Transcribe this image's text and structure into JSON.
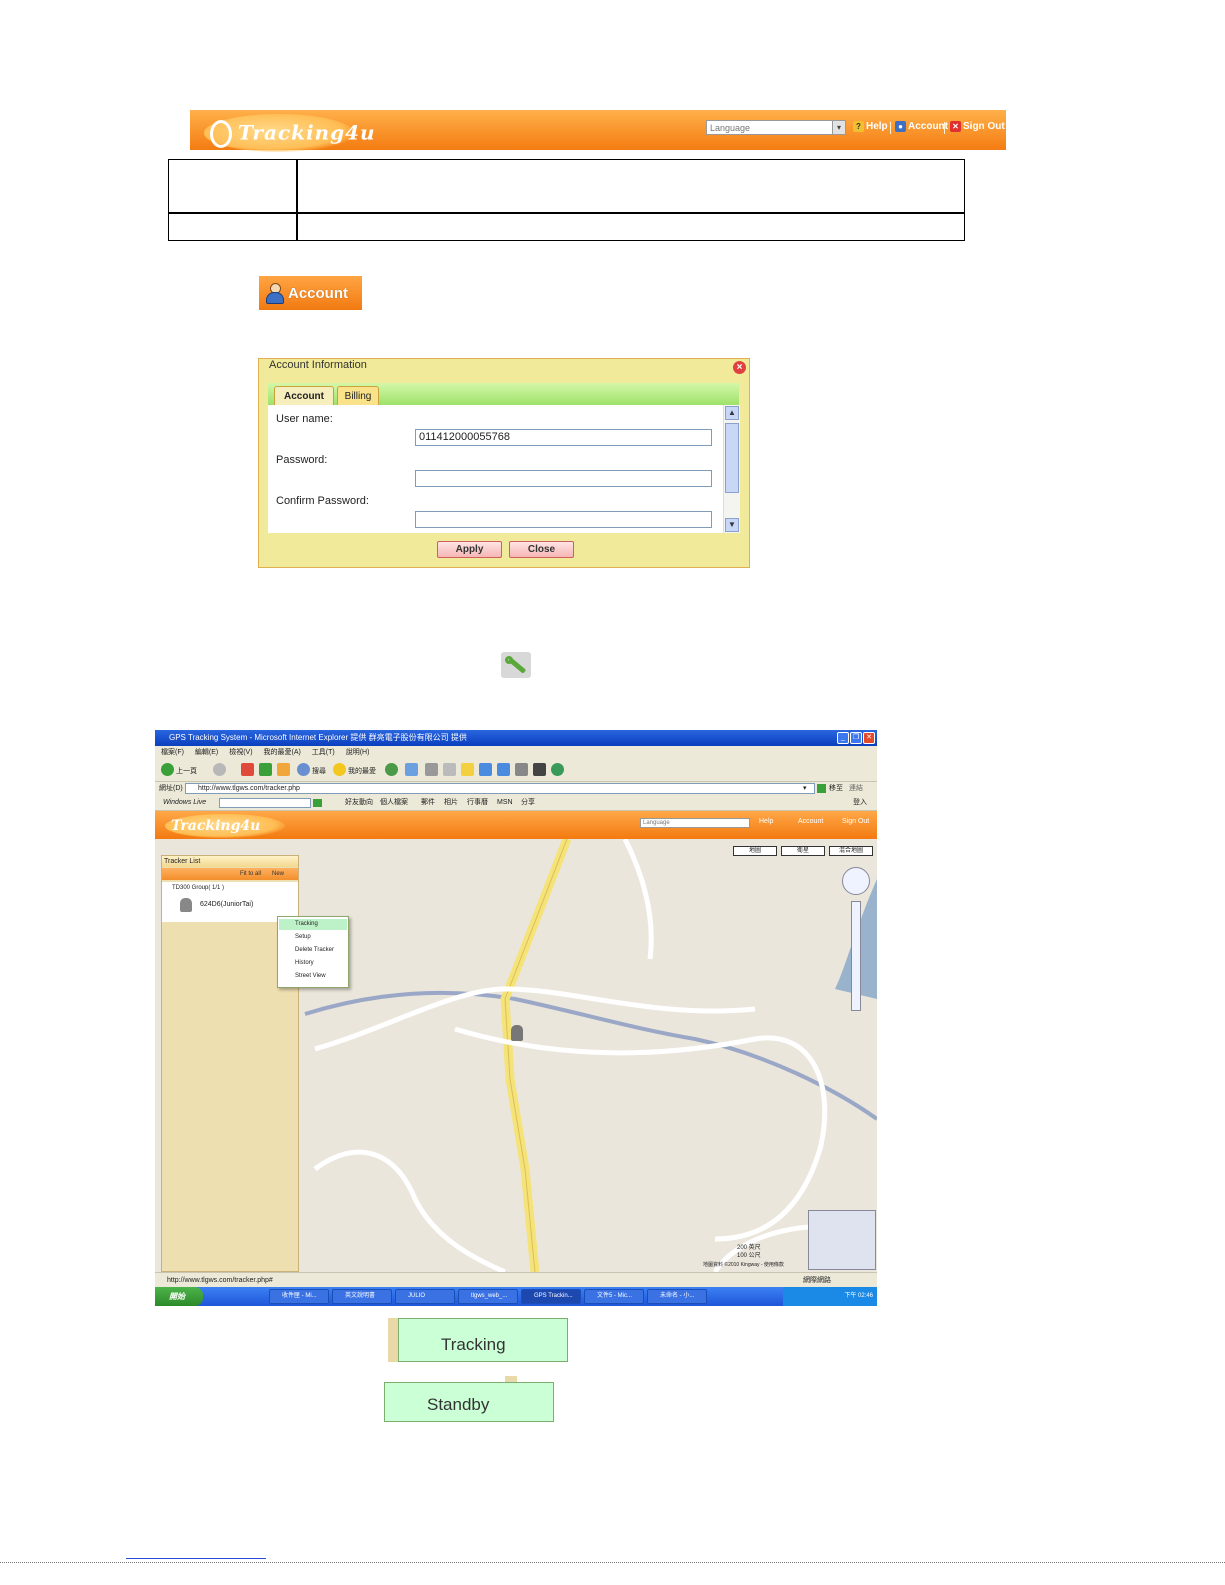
{
  "header": {
    "logo_text": "Tracking4u",
    "language_placeholder": "Language",
    "help_label": "Help",
    "account_label": "Account",
    "signout_label": "Sign Out"
  },
  "account_button": {
    "label": "Account"
  },
  "dialog": {
    "title": "Account Information",
    "tabs": [
      {
        "label": "Account",
        "active": true
      },
      {
        "label": "Billing",
        "active": false
      }
    ],
    "fields": [
      {
        "label": "User name:",
        "value": "011412000055768"
      },
      {
        "label": "Password:",
        "value": ""
      },
      {
        "label": "Confirm Password:",
        "value": ""
      }
    ],
    "apply_label": "Apply",
    "close_label": "Close"
  },
  "browser": {
    "window_title": "GPS Tracking System - Microsoft Internet Explorer 提供 群亮電子股份有限公司 提供",
    "menu": [
      "檔案(F)",
      "編輯(E)",
      "檢視(V)",
      "我的最愛(A)",
      "工具(T)",
      "說明(H)"
    ],
    "toolbar": {
      "back": "上一頁",
      "search": "搜尋",
      "favorites": "我的最愛"
    },
    "address_label": "網址(D)",
    "address": "http://www.tlgws.com/tracker.php",
    "go_label": "移至",
    "links_label": "連結",
    "live_label": "Windows Live",
    "live_links": [
      "好友動向",
      "個人檔案",
      "郵件",
      "相片",
      "行事曆",
      "MSN",
      "分享"
    ],
    "live_signin": "登入",
    "app": {
      "language_placeholder": "Language",
      "help": "Help",
      "account": "Account",
      "signout": "Sign Out"
    },
    "map_types": [
      "地圖",
      "衛星",
      "混合地圖"
    ],
    "tracker_panel": {
      "title": "Tracker List",
      "fit_label": "Fit to all",
      "new_label": "New",
      "group_label": "TD300 Group( 1/1 )",
      "tracker_name": "624D6(JuniorTai)"
    },
    "context_menu": [
      "Tracking",
      "Setup",
      "Delete Tracker",
      "History",
      "Street View"
    ],
    "scale": [
      "200 英尺",
      "100 公尺"
    ],
    "map_copyright": "地圖資料 ©2010 Kingway - 使用條款",
    "status_url": "http://www.tlgws.com/tracker.php#",
    "status_zone": "網際網路",
    "taskbar": {
      "start": "開始",
      "tasks": [
        "收件匣 - Mi...",
        "英文說明書",
        "JULIO",
        "tlgws_web_...",
        "GPS Trackin...",
        "文件5 - Mic...",
        "未命名 - 小..."
      ],
      "clock": "下午 02:46"
    }
  },
  "crops": {
    "tracking_label": "Tracking",
    "standby_label": "Standby"
  }
}
